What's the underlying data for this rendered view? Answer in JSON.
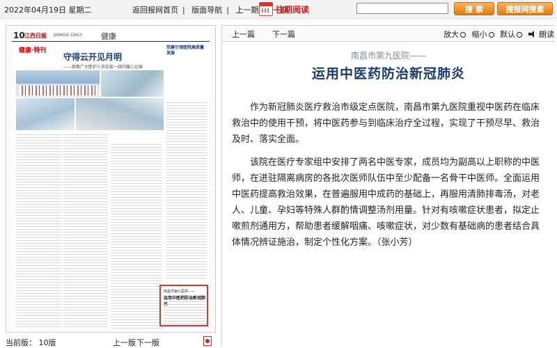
{
  "topbar": {
    "date": "2022年04月19日 星期二",
    "links": [
      "返回报网首页",
      "版面导航",
      "上一期",
      "下一期"
    ],
    "past_issues": "往期阅读",
    "search_placeholder": "",
    "search_button": "搜 索",
    "search_site_button": "搜报网搜素"
  },
  "page_preview": {
    "page_no": "10",
    "logo": "江西日报",
    "eng": "JIANGXI DAILY",
    "section": "健康",
    "mini_logo": "健康·特刊",
    "headline": "守得云开见月明",
    "subhead": "——致敬广大医护人员抗疫一线的暖心记录",
    "right_title": "党建引领医院高质量发展",
    "highlight_kicker": "南昌市第九医院——",
    "highlight_title": "运用中医药防治新冠肺炎"
  },
  "bottom": {
    "current_page": "当前版：  10版",
    "prev_page": "上一版",
    "next_page": "下一版"
  },
  "article_toolbar": {
    "prev": "上一篇",
    "next": "下一篇",
    "zoom_in": "放大",
    "zoom_out": "缩小",
    "default": "默认",
    "read_aloud": "朗读"
  },
  "article": {
    "kicker": "南昌市第九医院——",
    "title": "运用中医药防治新冠肺炎",
    "paragraphs": [
      "作为新冠肺炎医疗救治市级定点医院，南昌市第九医院重视中医药在临床救治中的使用干预，将中医药参与到临床治疗全过程，实现了干预尽早、救治及时、落实全面。",
      "该院在医疗专家组中安排了两名中医专家，成员均为副高以上职称的中医师，在进驻隔离病房的各批次医师队伍中至少配备一名骨干中医师。全面运用中医药提高救治效果，在普遍服用中成药的基础上，再服用清肺排毒汤，对老人、儿童、孕妇等特殊人群酌情调整汤剂用量。针对有咳嗽症状患者，拟定止嗽煎剂通用方，帮助患者缓解咽痛、咳嗽症状，对少数有基础病的患者结合具体情况辨证施治，制定个性化方案。（张小芳）"
    ]
  }
}
